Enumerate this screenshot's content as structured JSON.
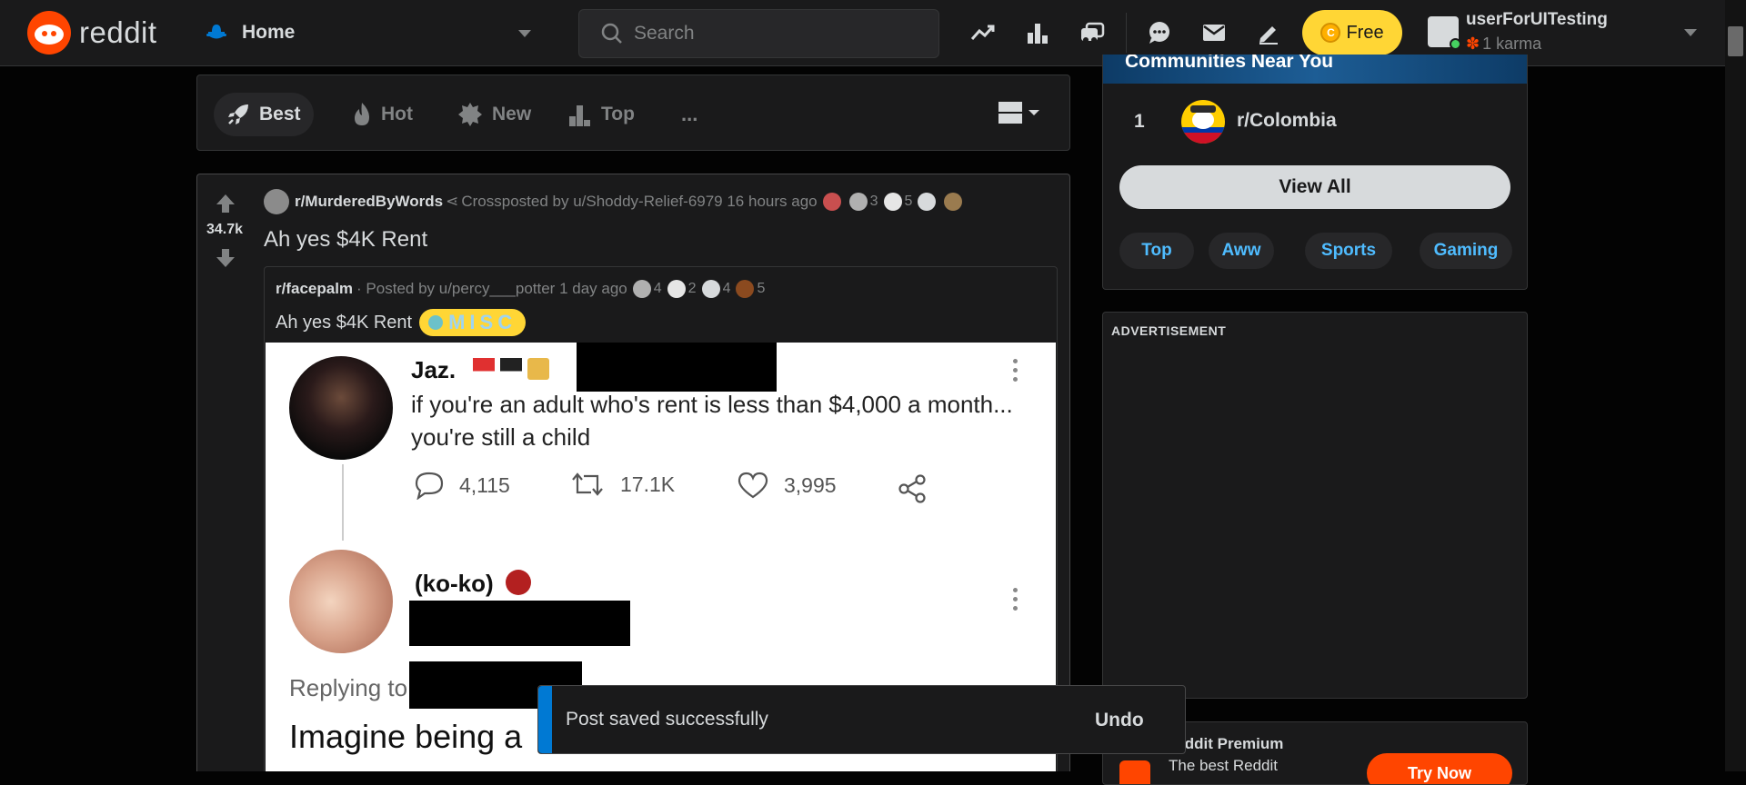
{
  "header": {
    "logo_text": "reddit",
    "home_label": "Home",
    "search_placeholder": "Search",
    "free_label": "Free",
    "username": "userForUITesting",
    "karma": "1 karma",
    "icons": [
      "popular-icon",
      "all-icon",
      "coins-icon",
      "chat-icon",
      "mail-icon",
      "create-post-icon"
    ]
  },
  "sort": {
    "items": [
      {
        "label": "Best",
        "icon": "rocket-icon",
        "active": true
      },
      {
        "label": "Hot",
        "icon": "flame-icon",
        "active": false
      },
      {
        "label": "New",
        "icon": "new-badge-icon",
        "active": false
      },
      {
        "label": "Top",
        "icon": "top-chart-icon",
        "active": false
      }
    ],
    "more": "...",
    "view_icon": "card-view-icon"
  },
  "post": {
    "score": "34.7k",
    "subreddit": "r/MurderedByWords",
    "crosspost_text": "Crossposted by u/Shoddy-Relief-6979 16 hours ago",
    "awards": [
      {
        "count": ""
      },
      {
        "count": "3"
      },
      {
        "count": "5"
      },
      {
        "count": ""
      },
      {
        "count": ""
      }
    ],
    "title": "Ah yes $4K Rent",
    "crosspost": {
      "subreddit": "r/facepalm",
      "posted_by": "· Posted by u/percy___potter 1 day ago",
      "awards": [
        {
          "count": "4"
        },
        {
          "count": "2"
        },
        {
          "count": "4"
        },
        {
          "count": "5"
        }
      ],
      "title": "Ah yes $4K Rent",
      "flair": "MISC"
    },
    "image": {
      "tweet1": {
        "name": "Jaz.",
        "line1": "if you're an adult who's rent is less than $4,000 a month...",
        "line2": "you're still a child",
        "replies": "4,115",
        "retweets": "17.1K",
        "likes": "3,995"
      },
      "tweet2": {
        "name": "(ko-ko)",
        "replying": "Replying to",
        "text": "Imagine being a"
      }
    }
  },
  "sidebar": {
    "communities_header": "Communities Near You",
    "community": {
      "rank": "1",
      "name": "r/Colombia"
    },
    "view_all": "View All",
    "chips": [
      "Top",
      "Aww",
      "Sports",
      "Gaming"
    ],
    "ad_label": "ADVERTISEMENT",
    "premium_title": "Reddit Premium",
    "premium_sub": "The best Reddit",
    "premium_button": "Try Now"
  },
  "toast": {
    "message": "Post saved successfully",
    "undo": "Undo"
  },
  "colors": {
    "accent": "#ff4500",
    "link": "#4fbcff",
    "toast_stripe": "#0079d3",
    "coin": "#ffd635"
  }
}
